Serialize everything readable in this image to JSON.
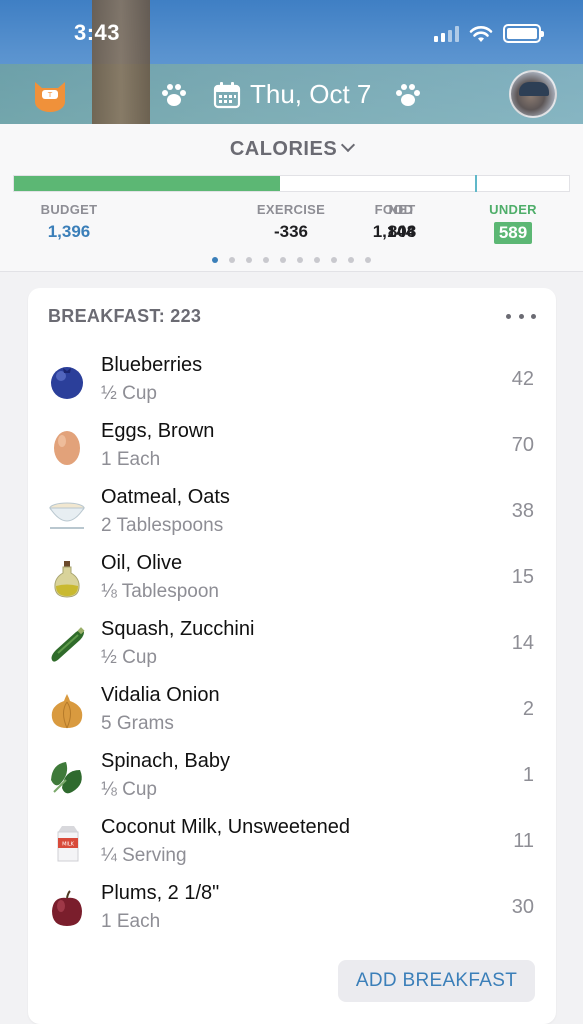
{
  "status_bar": {
    "time": "3:43"
  },
  "header": {
    "date": "Thu, Oct 7"
  },
  "summary": {
    "title": "CALORIES",
    "progress_fraction": 0.48,
    "stats": [
      {
        "key": "budget",
        "label": "BUDGET",
        "value": "1,396"
      },
      {
        "key": "food",
        "label": "FOOD",
        "value": "1,144"
      },
      {
        "key": "exercise",
        "label": "EXERCISE",
        "value": "-336"
      },
      {
        "key": "net",
        "label": "NET",
        "value": "808"
      },
      {
        "key": "under",
        "label": "UNDER",
        "value": "589"
      }
    ],
    "page_count": 10,
    "active_page": 1
  },
  "breakfast": {
    "title": "BREAKFAST: 223",
    "items": [
      {
        "name": "Blueberries",
        "serving": "½ Cup",
        "calories": "42",
        "icon": "blueberry-icon"
      },
      {
        "name": "Eggs, Brown",
        "serving": "1 Each",
        "calories": "70",
        "icon": "egg-icon"
      },
      {
        "name": "Oatmeal, Oats",
        "serving": "2 Tablespoons",
        "calories": "38",
        "icon": "bowl-icon"
      },
      {
        "name": "Oil, Olive",
        "serving": "⅛ Tablespoon",
        "calories": "15",
        "icon": "olive-oil-icon"
      },
      {
        "name": "Squash, Zucchini",
        "serving": "½ Cup",
        "calories": "14",
        "icon": "zucchini-icon"
      },
      {
        "name": "Vidalia Onion",
        "serving": "5 Grams",
        "calories": "2",
        "icon": "onion-icon"
      },
      {
        "name": "Spinach, Baby",
        "serving": "⅛ Cup",
        "calories": "1",
        "icon": "spinach-icon"
      },
      {
        "name": "Coconut Milk, Unsweetened",
        "serving": "¼ Serving",
        "calories": "11",
        "icon": "milk-carton-icon",
        "icon_text": "MILK"
      },
      {
        "name": "Plums, 2 1/8\"",
        "serving": "1 Each",
        "calories": "30",
        "icon": "plum-icon"
      }
    ],
    "add_label": "ADD BREAKFAST"
  },
  "colors": {
    "accent_blue": "#3b7fb9",
    "progress_green": "#5cb774",
    "under_green": "#4fae6a"
  }
}
